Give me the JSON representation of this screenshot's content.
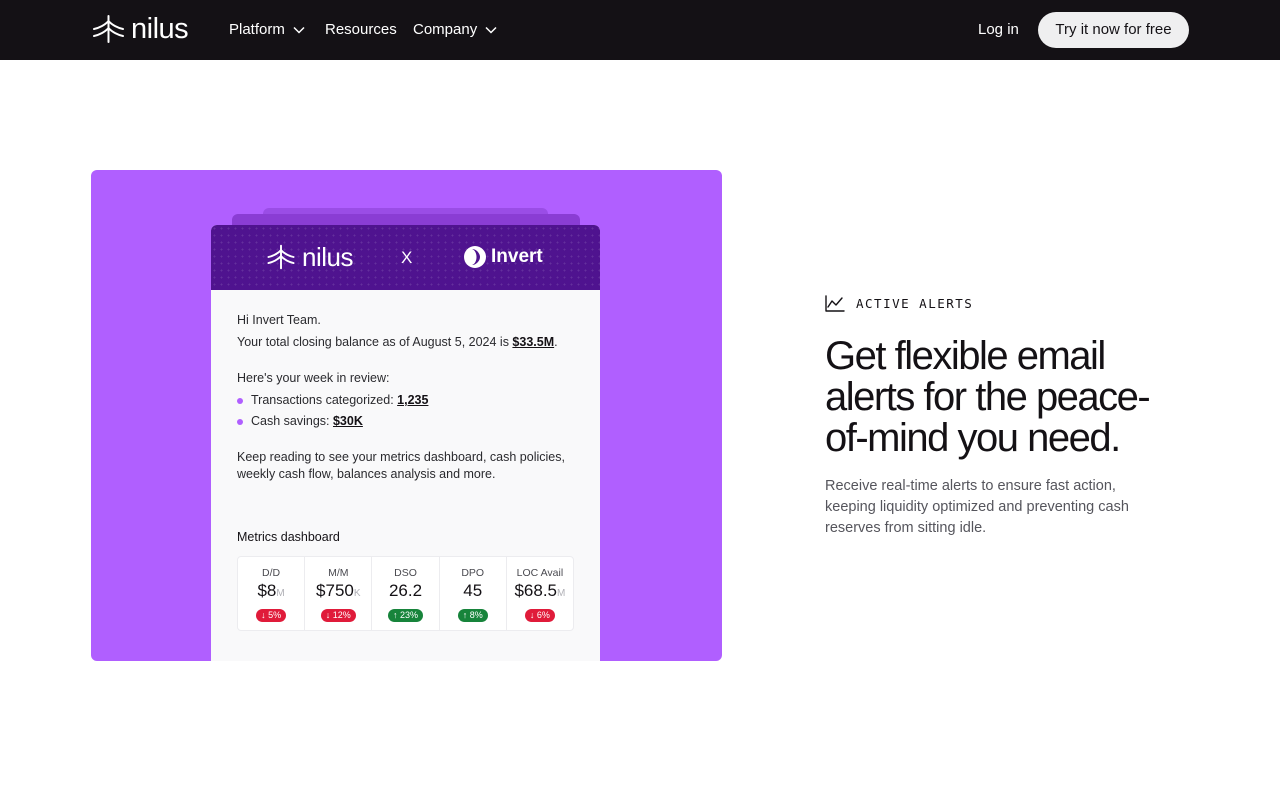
{
  "nav": {
    "brand": "nilus",
    "items": [
      {
        "label": "Platform",
        "has_dropdown": true
      },
      {
        "label": "Resources",
        "has_dropdown": false
      },
      {
        "label": "Company",
        "has_dropdown": true
      }
    ],
    "login": "Log in",
    "cta": "Try it now for free"
  },
  "email": {
    "header": {
      "left_brand": "nilus",
      "separator": "X",
      "right_brand": "Invert"
    },
    "greeting": "Hi Invert Team.",
    "balance_prefix": "Your total closing balance as of August 5, 2024 is ",
    "balance_value": "$33.5M",
    "balance_suffix": ".",
    "week_intro": "Here's your week in review:",
    "bullets": [
      {
        "label": "Transactions categorized: ",
        "value": "1,235"
      },
      {
        "label": "Cash savings: ",
        "value": "$30K"
      }
    ],
    "paragraph": "Keep reading to see your metrics dashboard, cash policies, weekly cash flow, balances analysis and more.",
    "metrics_title": "Metrics dashboard",
    "metrics": [
      {
        "label": "D/D",
        "value": "$8",
        "unit": "M",
        "change": "5%",
        "direction": "down"
      },
      {
        "label": "M/M",
        "value": "$750",
        "unit": "K",
        "change": "12%",
        "direction": "down"
      },
      {
        "label": "DSO",
        "value": "26.2",
        "unit": "",
        "change": "23%",
        "direction": "up"
      },
      {
        "label": "DPO",
        "value": "45",
        "unit": "",
        "change": "8%",
        "direction": "up"
      },
      {
        "label": "LOC Avail",
        "value": "$68.5",
        "unit": "M",
        "change": "6%",
        "direction": "down"
      }
    ]
  },
  "section": {
    "eyebrow": "ACTIVE ALERTS",
    "eyebrow_icon": "line-chart-icon",
    "headline": "Get flexible email alerts for the peace-of-mind you need.",
    "subtext": "Receive real-time alerts to ensure fast action, keeping liquidity optimized and preventing cash reserves from sitting idle."
  },
  "colors": {
    "nav_bg": "#141115",
    "card_bg": "#b05fff",
    "email_header_bg": "#4f138f",
    "down": "#e01b3a",
    "up": "#17843b"
  }
}
